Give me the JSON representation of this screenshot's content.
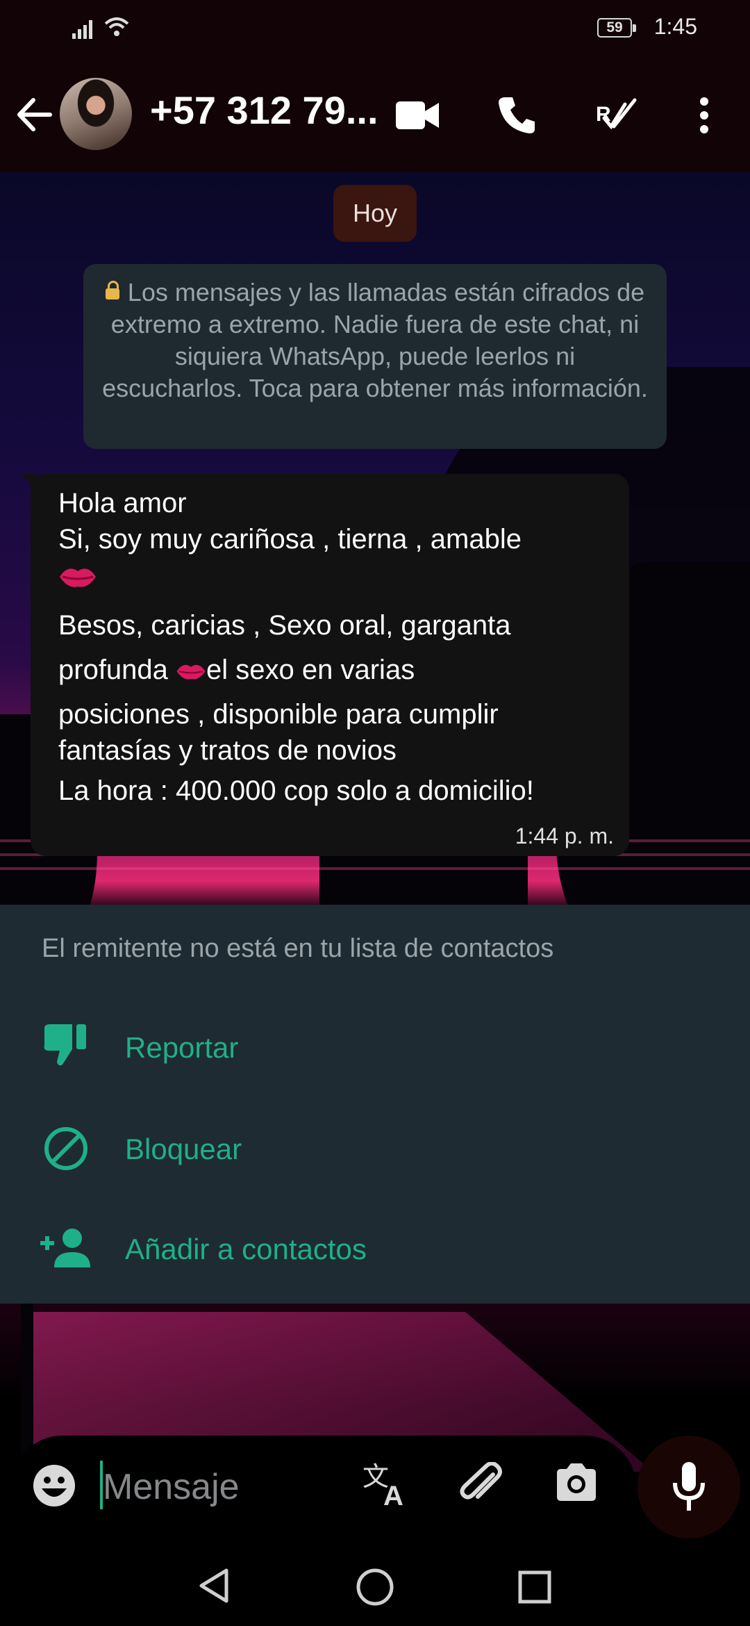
{
  "status_bar": {
    "time": "1:45",
    "battery": "59"
  },
  "header": {
    "contact_name": "+57 312 79..."
  },
  "chat": {
    "date_chip": "Hoy",
    "encryption_notice": "Los mensajes y las llamadas están cifrados de extremo a extremo. Nadie fuera de este chat, ni siquiera WhatsApp, puede leerlos ni escucharlos. Toca para obtener más información.",
    "message": {
      "lines": [
        "Hola amor",
        "Si, soy muy cariñosa , tierna , amable",
        "",
        " Besos, caricias , Sexo oral, garganta",
        "profunda ",
        "el sexo en varias",
        "posiciones , disponible para cumplir",
        "fantasías y tratos de novios",
        "La hora : 400.000 cop solo a domicilio!"
      ],
      "time": "1:44 p. m."
    }
  },
  "unknown_sender_panel": {
    "title": "El remitente no está en tu lista de contactos",
    "actions": [
      {
        "label": "Reportar",
        "icon": "thumb-down-icon"
      },
      {
        "label": "Bloquear",
        "icon": "block-icon"
      },
      {
        "label": "Añadir a contactos",
        "icon": "person-add-icon"
      }
    ]
  },
  "composer": {
    "placeholder": "Mensaje"
  },
  "colors": {
    "accent": "#1fb089",
    "panel": "#1f2b32",
    "bubble": "#121212",
    "header": "#120406"
  }
}
